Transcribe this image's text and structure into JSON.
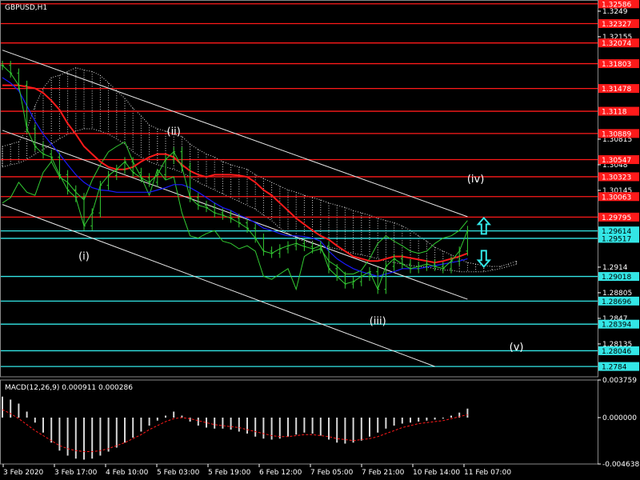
{
  "chart_data": [
    {
      "type": "line",
      "title": "GBPUSD,H1",
      "ylim": [
        1.27705,
        1.32636
      ],
      "grid": false,
      "colors": {
        "background": "#000000",
        "price": "#33cc33",
        "rsi_line": "#33cc33",
        "ma_fast": "#1a1aff",
        "ma_slow": "#ff1a1a",
        "cloud": "#d8d8d8",
        "channel": "#e8e8e8",
        "resistance": "#ff1a1a",
        "support": "#33e6e6",
        "label_text": "#ffffff",
        "arrow": "#33e6e6"
      },
      "x_ticks": [
        "3 Feb 2020",
        "3 Feb 17:00",
        "4 Feb 10:00",
        "5 Feb 03:00",
        "5 Feb 19:00",
        "6 Feb 12:00",
        "7 Feb 05:00",
        "7 Feb 21:00",
        "10 Feb 14:00",
        "11 Feb 07:00"
      ],
      "y_ticks": [
        1.3249,
        1.32155,
        1.30815,
        1.3048,
        1.30145,
        1.2914,
        1.28805,
        1.2847,
        1.28135
      ],
      "resistance_levels": [
        1.32586,
        1.32327,
        1.32074,
        1.31803,
        1.31478,
        1.3118,
        1.30889,
        1.30547,
        1.30323,
        1.30063,
        1.29795
      ],
      "support_levels": [
        1.29614,
        1.29517,
        1.29018,
        1.28696,
        1.28394,
        1.28046,
        1.2784
      ],
      "price_labels": [
        "1.32586",
        "1.32327",
        "1.32074",
        "1.31803",
        "1.31478",
        "1.3118",
        "1.30889",
        "1.30547",
        "1.30323",
        "1.30063",
        "1.29795",
        "1.29614",
        "1.29517",
        "1.29018",
        "1.28696",
        "1.28394",
        "1.28046",
        "1.2784"
      ],
      "wave_labels": [
        {
          "text": "(i)",
          "bar": 10,
          "value": 1.2924
        },
        {
          "text": "(ii)",
          "bar": 21,
          "value": 1.3087
        },
        {
          "text": "(iii)",
          "bar": 46,
          "value": 1.2839
        },
        {
          "text": "(iv)",
          "bar": 58,
          "value": 1.3025
        },
        {
          "text": "(v)",
          "bar": 63,
          "value": 1.2805
        }
      ],
      "arrows": [
        {
          "direction": "up",
          "bar": 59,
          "value": 1.2968
        },
        {
          "direction": "down",
          "bar": 59,
          "value": 1.2925
        }
      ],
      "channels": [
        {
          "from": {
            "bar": 0,
            "value": 1.3198
          },
          "to": {
            "bar": 57,
            "value": 1.298
          }
        },
        {
          "from": {
            "bar": 0,
            "value": 1.3093
          },
          "to": {
            "bar": 57,
            "value": 1.2872
          }
        },
        {
          "from": {
            "bar": 0,
            "value": 1.2996
          },
          "to": {
            "bar": 53,
            "value": 1.2784
          }
        }
      ],
      "series": [
        {
          "name": "",
          "role": "price",
          "values": [
            1.3178,
            1.3168,
            1.3152,
            1.3095,
            1.3072,
            1.3062,
            1.3058,
            1.3035,
            1.3015,
            1.3005,
            1.2968,
            1.2985,
            1.3021,
            1.3034,
            1.3042,
            1.3052,
            1.3038,
            1.3031,
            1.3025,
            1.3035,
            1.3055,
            1.3065,
            1.3045,
            1.3005,
            1.2995,
            1.2992,
            1.2985,
            1.2982,
            1.2978,
            1.2972,
            1.2965,
            1.2952,
            1.2935,
            1.2932,
            1.2938,
            1.2942,
            1.2945,
            1.2941,
            1.2938,
            1.2942,
            1.2912,
            1.2902,
            1.2892,
            1.2895,
            1.2902,
            1.2908,
            1.2885,
            1.2915,
            1.2925,
            1.2918,
            1.2912,
            1.2915,
            1.2918,
            1.2915,
            1.2912,
            1.2922,
            1.2935,
            1.2962
          ]
        },
        {
          "name": "",
          "role": "ma_fast",
          "values": [
            1.3162,
            1.3155,
            1.3145,
            1.3125,
            1.3105,
            1.3088,
            1.3075,
            1.3062,
            1.3048,
            1.3035,
            1.3025,
            1.3018,
            1.3015,
            1.3014,
            1.3012,
            1.3012,
            1.3012,
            1.3012,
            1.3012,
            1.3015,
            1.3018,
            1.3022,
            1.3022,
            1.3018,
            1.3012,
            1.3005,
            1.2998,
            1.2992,
            1.2988,
            1.2982,
            1.2978,
            1.2972,
            1.2965,
            1.2962,
            1.2958,
            1.2955,
            1.2955,
            1.2954,
            1.2952,
            1.2948,
            1.2935,
            1.2925,
            1.2918,
            1.2912,
            1.2908,
            1.2905,
            1.2902,
            1.2905,
            1.2908,
            1.2912,
            1.2912,
            1.2912,
            1.2914,
            1.2916,
            1.2918,
            1.292,
            1.2922,
            1.2925
          ]
        },
        {
          "name": "",
          "role": "ma_slow",
          "values": [
            1.3152,
            1.3152,
            1.3152,
            1.315,
            1.3148,
            1.3142,
            1.3132,
            1.312,
            1.3102,
            1.3088,
            1.3072,
            1.3062,
            1.3052,
            1.3045,
            1.3042,
            1.3042,
            1.3045,
            1.3052,
            1.3058,
            1.3062,
            1.3062,
            1.3058,
            1.3048,
            1.304,
            1.3035,
            1.3032,
            1.3035,
            1.3035,
            1.3035,
            1.3034,
            1.3032,
            1.3025,
            1.3015,
            1.3008,
            1.2998,
            1.2988,
            1.2978,
            1.297,
            1.2962,
            1.2955,
            1.295,
            1.2942,
            1.2935,
            1.2928,
            1.2925,
            1.2922,
            1.2922,
            1.2925,
            1.2928,
            1.2928,
            1.2926,
            1.2924,
            1.2922,
            1.292,
            1.2922,
            1.2925,
            1.2928,
            1.2932
          ]
        },
        {
          "name": "",
          "role": "rsi_line",
          "values": [
            1.2998,
            1.3005,
            1.3025,
            1.3012,
            1.3008,
            1.3038,
            1.3052,
            1.3032,
            1.3025,
            1.3012,
            1.3002,
            1.3028,
            1.3048,
            1.3065,
            1.3072,
            1.3078,
            1.3052,
            1.3032,
            1.3008,
            1.3042,
            1.3028,
            1.3032,
            1.2985,
            1.2955,
            1.2952,
            1.2958,
            1.2962,
            1.2948,
            1.2945,
            1.2938,
            1.2942,
            1.2935,
            1.2902,
            1.2898,
            1.2905,
            1.2912,
            1.2885,
            1.2928,
            1.2935,
            1.2938,
            1.2922,
            1.2915,
            1.2905,
            1.2905,
            1.291,
            1.2925,
            1.2945,
            1.2955,
            1.2948,
            1.2942,
            1.2935,
            1.2932,
            1.2935,
            1.2945,
            1.2952,
            1.2955,
            1.2962,
            1.2975
          ]
        },
        {
          "name": "",
          "role": "cloud_upper",
          "values": [
            1.3072,
            1.3075,
            1.3078,
            1.3095,
            1.3125,
            1.3148,
            1.3162,
            1.3165,
            1.317,
            1.3175,
            1.3172,
            1.317,
            1.3165,
            1.3155,
            1.3145,
            1.3135,
            1.3122,
            1.3112,
            1.31,
            1.3095,
            1.3092,
            1.3088,
            1.3085,
            1.3075,
            1.3068,
            1.3062,
            1.3058,
            1.3052,
            1.3048,
            1.3045,
            1.3042,
            1.3035,
            1.303,
            1.3025,
            1.302,
            1.3015,
            1.3012,
            1.3008,
            1.3005,
            1.3002,
            1.2998,
            1.2995,
            1.2992,
            1.2988,
            1.2985,
            1.2982,
            1.2978,
            1.2975,
            1.2972,
            1.2968,
            1.2962,
            1.2955,
            1.2948,
            1.294,
            1.2935,
            1.293,
            1.2925,
            1.292,
            1.2918,
            1.2916,
            1.2915,
            1.2915,
            1.2918,
            1.2922
          ]
        },
        {
          "name": "",
          "role": "cloud_lower",
          "values": [
            1.3045,
            1.3048,
            1.305,
            1.3055,
            1.3062,
            1.3068,
            1.3075,
            1.3082,
            1.3088,
            1.3092,
            1.3095,
            1.3095,
            1.3092,
            1.3088,
            1.3082,
            1.3075,
            1.3065,
            1.3058,
            1.3052,
            1.3048,
            1.3045,
            1.3042,
            1.3038,
            1.3032,
            1.3025,
            1.302,
            1.3015,
            1.301,
            1.3005,
            1.3,
            1.2995,
            1.299,
            1.2982,
            1.2975,
            1.2965,
            1.2958,
            1.2952,
            1.2948,
            1.2945,
            1.2942,
            1.294,
            1.2938,
            1.2935,
            1.2932,
            1.293,
            1.2928,
            1.2925,
            1.2922,
            1.292,
            1.2918,
            1.2916,
            1.2915,
            1.2914,
            1.2912,
            1.291,
            1.291,
            1.2908,
            1.2908,
            1.2908,
            1.2908,
            1.291,
            1.2912,
            1.2915,
            1.2918
          ]
        }
      ]
    },
    {
      "type": "bar",
      "title": "MACD(12,26,9) 0.000911 0.000286",
      "ylim": [
        -0.004638,
        0.003759
      ],
      "grid": false,
      "y_ticks": [
        0.003759,
        0.0,
        -0.004638
      ],
      "y_tick_labels": [
        "0.003759",
        "0.000000",
        "-0.004638"
      ],
      "colors": {
        "histogram": "#d8d8d8",
        "signal": "#ff1a1a"
      },
      "series": [
        {
          "name": "",
          "role": "histogram",
          "values": [
            0.0021,
            0.0018,
            0.0014,
            0.0006,
            -0.0005,
            -0.0015,
            -0.0025,
            -0.0033,
            -0.0038,
            -0.0041,
            -0.0042,
            -0.0041,
            -0.0038,
            -0.0034,
            -0.003,
            -0.0025,
            -0.002,
            -0.0014,
            -0.0008,
            -0.0003,
            0.0002,
            0.0006,
            0.0002,
            -0.0004,
            -0.0008,
            -0.001,
            -0.0011,
            -0.0011,
            -0.0012,
            -0.0014,
            -0.0016,
            -0.0019,
            -0.0021,
            -0.0022,
            -0.0021,
            -0.0019,
            -0.0017,
            -0.0015,
            -0.0016,
            -0.0018,
            -0.0022,
            -0.0025,
            -0.0026,
            -0.0025,
            -0.0023,
            -0.0019,
            -0.0015,
            -0.0011,
            -0.0008,
            -0.0006,
            -0.0005,
            -0.0004,
            -0.0003,
            -0.0002,
            -0.0001,
            0.0002,
            0.0005,
            0.0009
          ]
        },
        {
          "name": "",
          "role": "signal",
          "values": [
            0.0008,
            0.0004,
            -0.0001,
            -0.0007,
            -0.0013,
            -0.0018,
            -0.0023,
            -0.0028,
            -0.0031,
            -0.0033,
            -0.0034,
            -0.0034,
            -0.0033,
            -0.0031,
            -0.0028,
            -0.0025,
            -0.0021,
            -0.0017,
            -0.0012,
            -0.0008,
            -0.0004,
            -0.0001,
            0.0,
            -0.0001,
            -0.0003,
            -0.0005,
            -0.0007,
            -0.0008,
            -0.0009,
            -0.001,
            -0.0012,
            -0.0014,
            -0.0016,
            -0.0018,
            -0.0019,
            -0.0019,
            -0.0018,
            -0.0017,
            -0.0017,
            -0.0018,
            -0.0019,
            -0.0021,
            -0.0022,
            -0.0023,
            -0.0022,
            -0.0021,
            -0.0019,
            -0.0016,
            -0.0013,
            -0.001,
            -0.0008,
            -0.0006,
            -0.0005,
            -0.0004,
            -0.0003,
            -0.0001,
            0.0001,
            0.0003
          ]
        }
      ]
    }
  ]
}
